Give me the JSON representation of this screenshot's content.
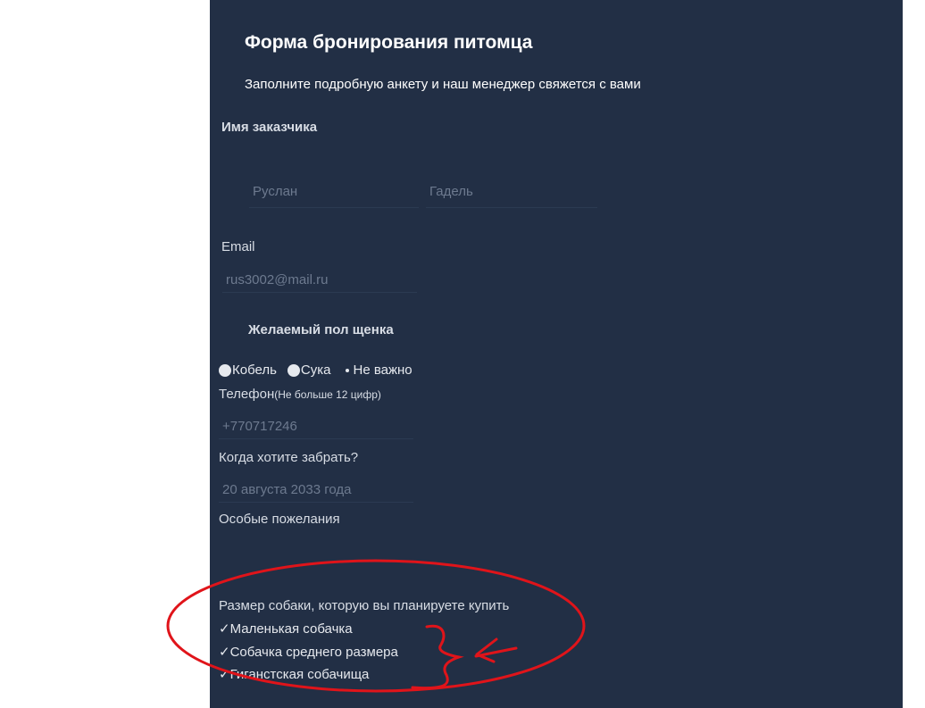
{
  "form": {
    "title": "Форма бронирования питомца",
    "subtitle": "Заполните подробную анкету и наш менеджер свяжется с вами",
    "customer_label": "Имя заказчика",
    "first_name_placeholder": "Руслан",
    "last_name_placeholder": "Гадель",
    "email_label": "Email",
    "email_placeholder": "rus3002@mail.ru",
    "sex_label": "Желаемый пол щенка",
    "sex_options": [
      "Кобель",
      "Сука",
      "Не важно"
    ],
    "phone_label": "Телефон",
    "phone_note": "(Не больше 12 цифр)",
    "phone_placeholder": "+770717246",
    "pickup_label": "Когда хотите забрать?",
    "pickup_placeholder": "20 августа 2033 года",
    "wishes_label": "Особые пожелания",
    "size_label": "Размер собаки, которую вы планируете купить",
    "size_options": [
      "Маленькая собачка",
      "Собачка среднего размера",
      "Гиганстская собачища"
    ],
    "check_glyph": "✓"
  },
  "colors": {
    "panel_bg": "#222f45",
    "annotation_red": "#e0141a"
  }
}
